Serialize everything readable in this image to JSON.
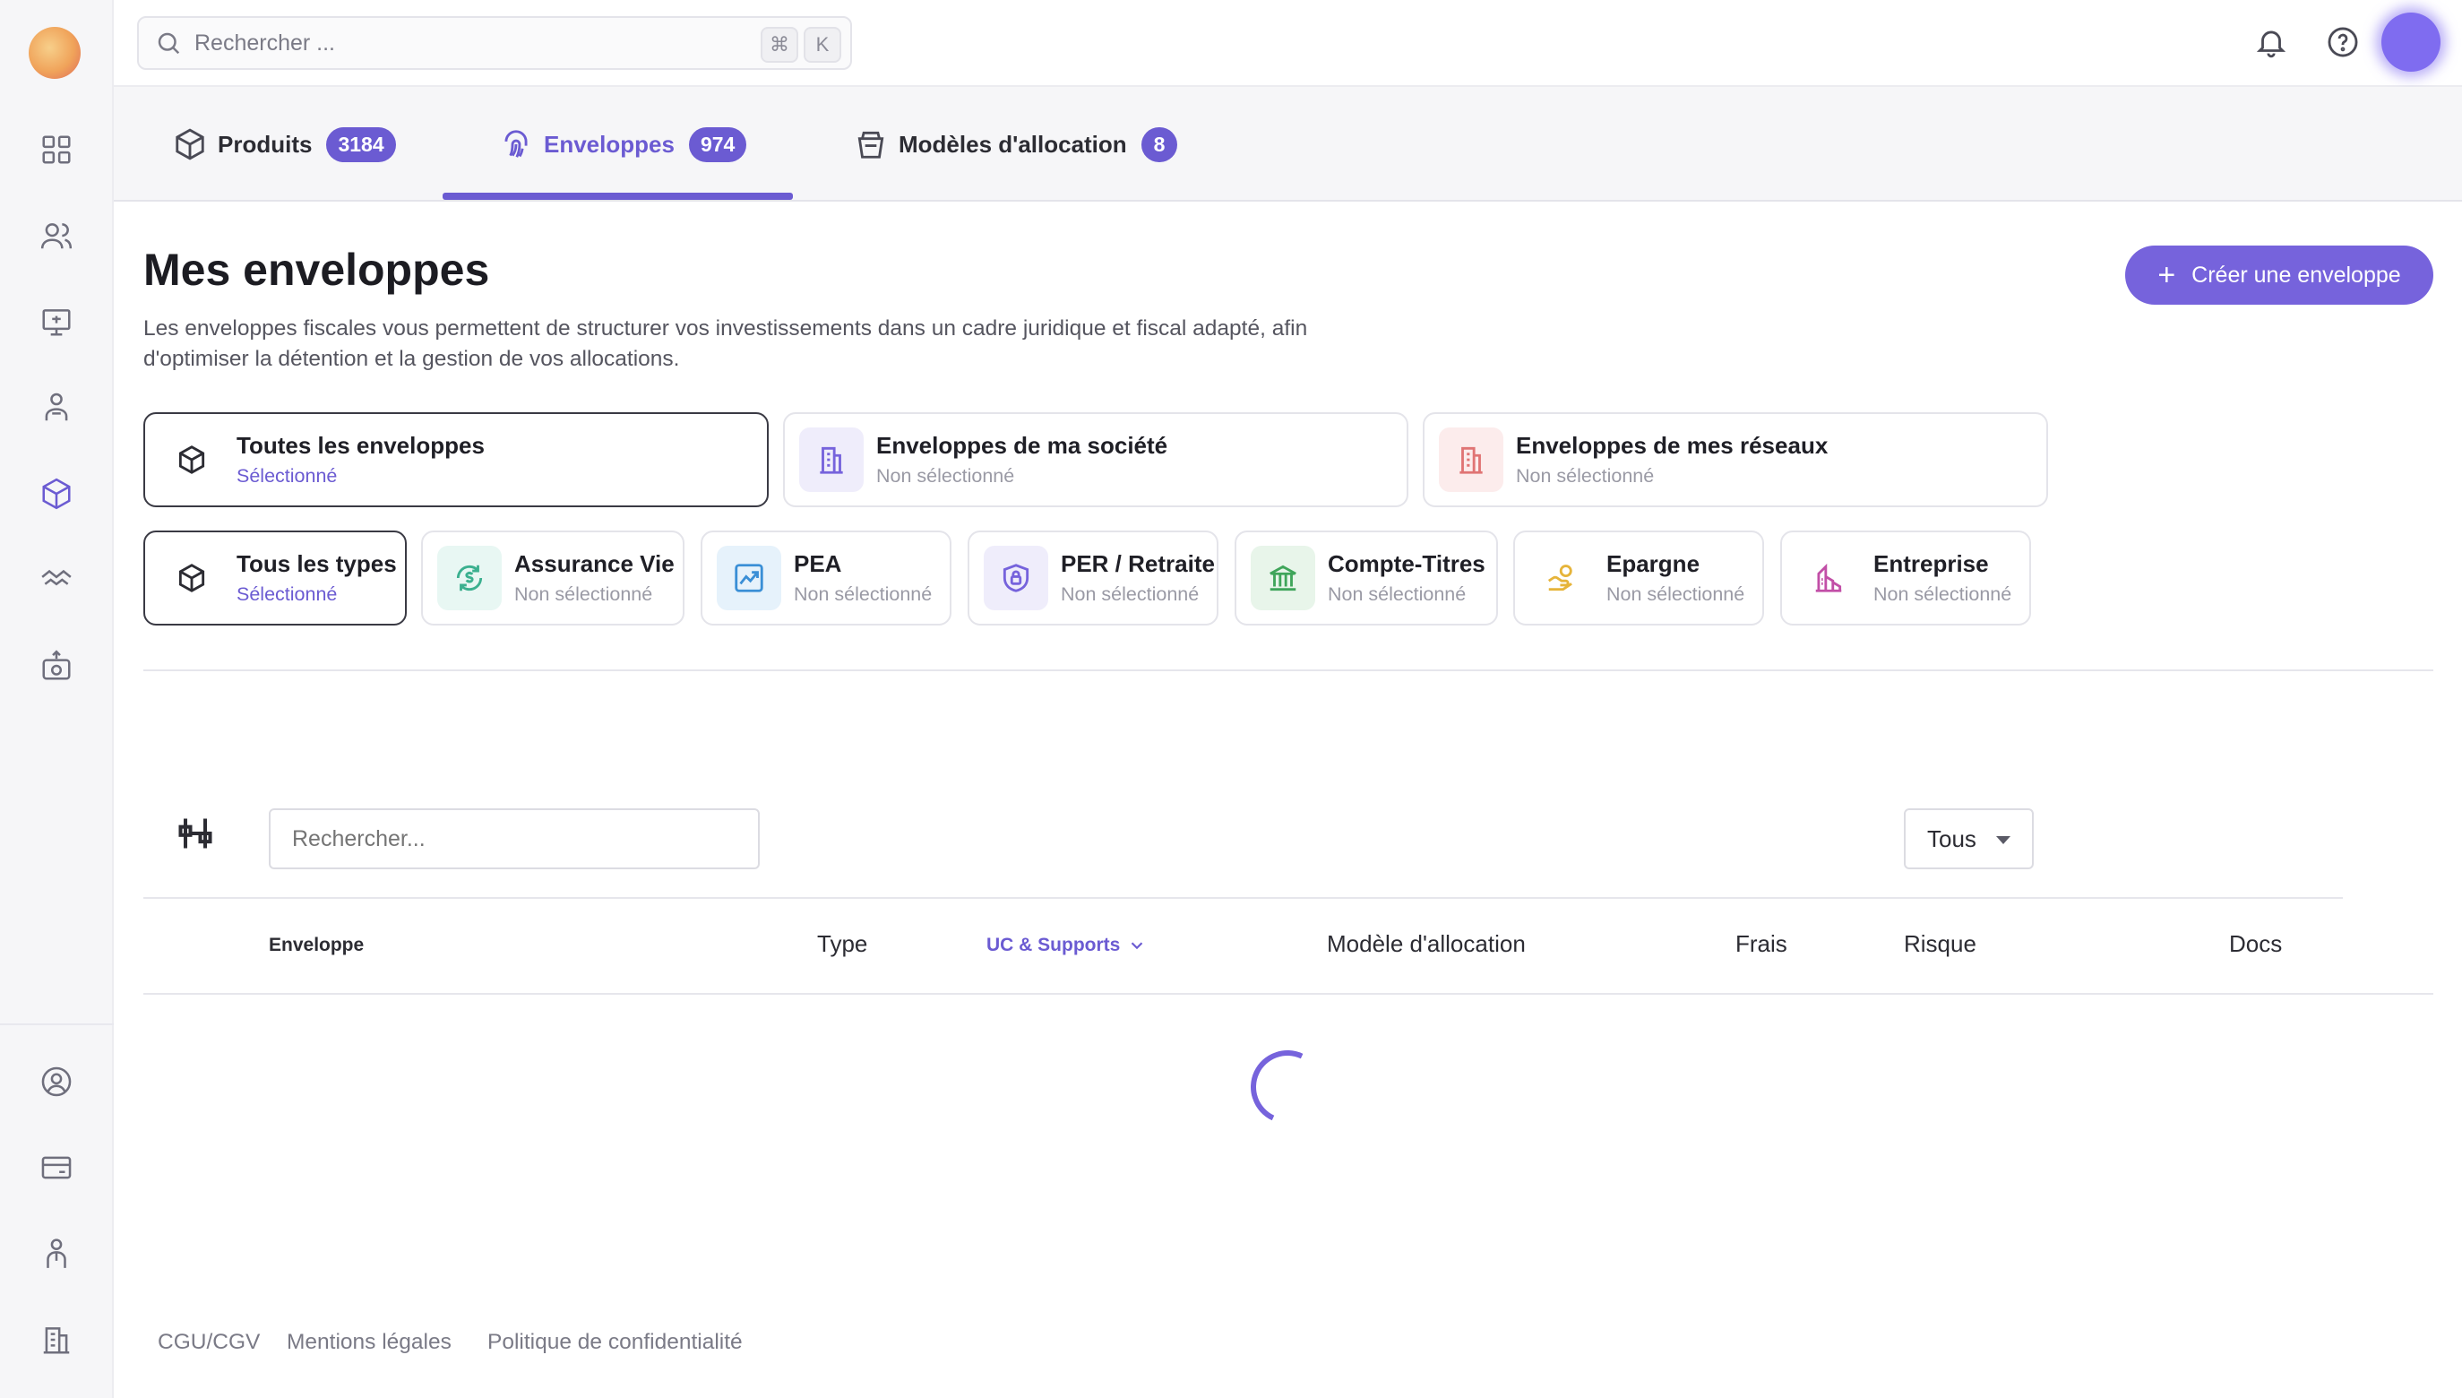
{
  "search": {
    "placeholder": "Rechercher ...",
    "kbd_cmd": "⌘",
    "kbd_key": "K"
  },
  "tabs": [
    {
      "label": "Produits",
      "count": "3184",
      "icon": "cube-icon",
      "active": false
    },
    {
      "label": "Enveloppes",
      "count": "974",
      "icon": "fingerprint-icon",
      "active": true
    },
    {
      "label": "Modèles d'allocation",
      "count": "8",
      "icon": "basket-icon",
      "active": false
    }
  ],
  "page": {
    "title": "Mes enveloppes",
    "description": "Les enveloppes fiscales vous permettent de structurer vos investissements dans un cadre juridique et fiscal adapté, afin d'optimiser la détention et la gestion de vos allocations.",
    "create_button": "Créer une enveloppe"
  },
  "scope_filters": [
    {
      "label": "Toutes les enveloppes",
      "status": "Sélectionné",
      "selected": true,
      "icon": "cube-icon"
    },
    {
      "label": "Enveloppes de ma société",
      "status": "Non sélectionné",
      "selected": false,
      "icon": "building-icon"
    },
    {
      "label": "Enveloppes de mes réseaux",
      "status": "Non sélectionné",
      "selected": false,
      "icon": "building-icon"
    }
  ],
  "type_filters": [
    {
      "label": "Tous les types",
      "status": "Sélectionné",
      "selected": true,
      "icon": "cube-icon"
    },
    {
      "label": "Assurance Vie",
      "status": "Non sélectionné",
      "selected": false,
      "icon": "dollar-cycle-icon"
    },
    {
      "label": "PEA",
      "status": "Non sélectionné",
      "selected": false,
      "icon": "chart-icon"
    },
    {
      "label": "PER / Retraite",
      "status": "Non sélectionné",
      "selected": false,
      "icon": "shield-lock-icon"
    },
    {
      "label": "Compte-Titres",
      "status": "Non sélectionné",
      "selected": false,
      "icon": "bank-icon"
    },
    {
      "label": "Epargne",
      "status": "Non sélectionné",
      "selected": false,
      "icon": "coins-hand-icon"
    },
    {
      "label": "Entreprise",
      "status": "Non sélectionné",
      "selected": false,
      "icon": "factory-icon"
    }
  ],
  "table": {
    "search_placeholder": "Rechercher...",
    "select_value": "Tous",
    "columns": [
      "Enveloppe",
      "Type",
      "UC & Supports",
      "Modèle d'allocation",
      "Frais",
      "Risque",
      "Docs"
    ]
  },
  "footer": {
    "links": [
      "CGU/CGV",
      "Mentions légales",
      "Politique de confidentialité"
    ]
  },
  "colors": {
    "accent": "#6b5bd2",
    "accent_button": "#7663dc"
  }
}
